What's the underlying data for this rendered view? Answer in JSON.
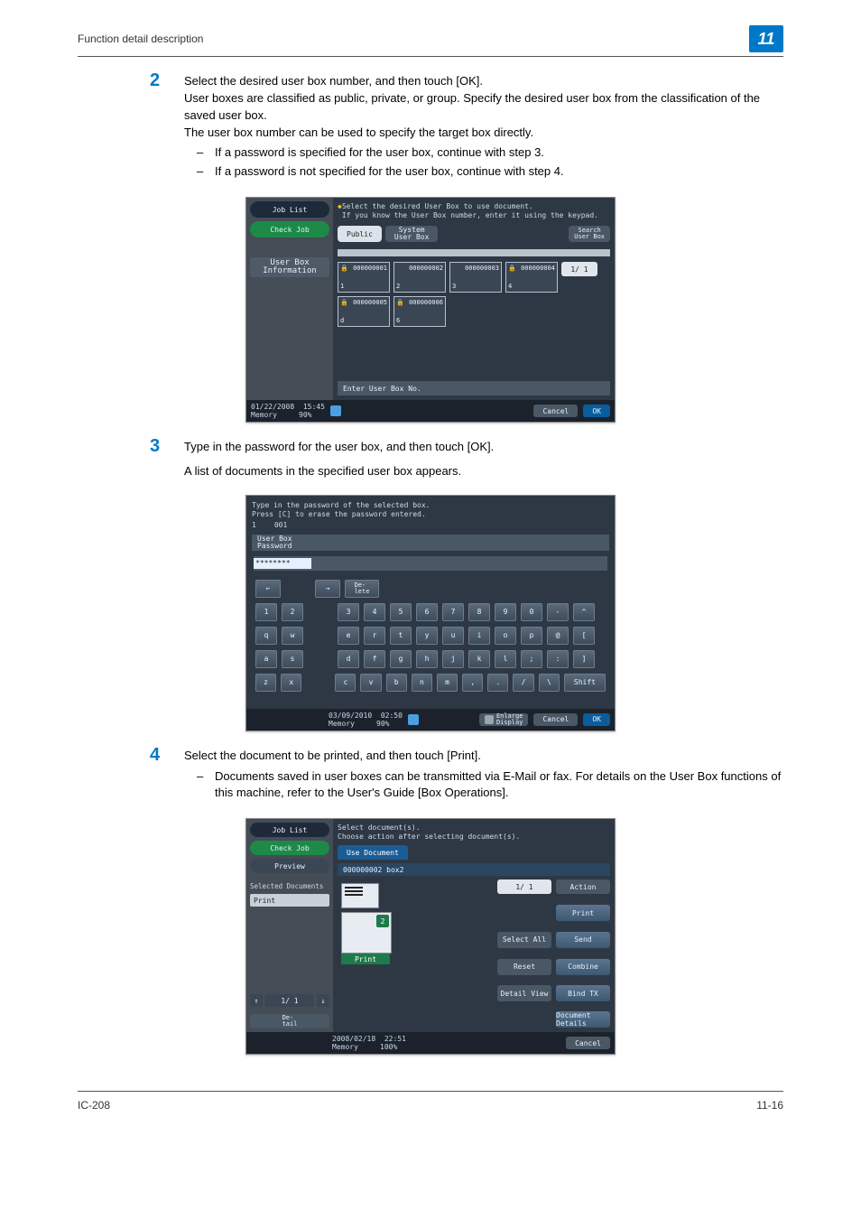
{
  "header": {
    "title": "Function detail description",
    "chapter_number": "11"
  },
  "steps": {
    "s2": {
      "num": "2",
      "p1": "Select the desired user box number, and then touch [OK].",
      "p2": "User boxes are classified as public, private, or group. Specify the desired user box from the classification of the saved user box.",
      "p3": "The user box number can be used to specify the target box directly.",
      "b1": "If a password is specified for the user box, continue with step 3.",
      "b2": "If a password is not specified for the user box, continue with step 4."
    },
    "s3": {
      "num": "3",
      "p1": "Type in the password for the user box, and then touch [OK].",
      "p2": "A list of documents in the specified user box appears."
    },
    "s4": {
      "num": "4",
      "p1": "Select the document to be printed, and then touch [Print].",
      "b1": "Documents saved in user boxes can be transmitted via E-Mail or fax. For details on the User Box functions of this machine, refer to the User's Guide [Box Operations]."
    }
  },
  "shot1": {
    "left": {
      "job_list": "Job List",
      "check_job": "Check Job",
      "user_box_info": "User Box\nInformation"
    },
    "hint_line1": "Select the desired User Box to use document.",
    "hint_line2": "If you know the User Box number, enter it using the keypad.",
    "tab_public": "Public",
    "tab_system": "System\nUser Box",
    "search": "Search\nUser Box",
    "boxes": [
      {
        "num": "000000001",
        "label": "1",
        "lock": true
      },
      {
        "num": "000000002",
        "label": "2",
        "lock": false
      },
      {
        "num": "000000003",
        "label": "3",
        "lock": false
      },
      {
        "num": "000000004",
        "label": "4",
        "lock": true
      },
      {
        "num": "000000005",
        "label": "d",
        "lock": true
      },
      {
        "num": "000000006",
        "label": "6",
        "lock": true
      }
    ],
    "page_count": "1/ 1",
    "enter_label": "Enter User Box No.",
    "footer": {
      "date": "01/22/2008",
      "time": "15:45",
      "memory": "Memory",
      "memory_pct": "90%",
      "cancel": "Cancel",
      "ok": "OK"
    }
  },
  "shot2": {
    "hint_line1": "Type in the password of the selected box.",
    "hint_line2": "Press [C] to erase the password entered.",
    "hint_num": "1",
    "hint_id": "001",
    "tab": "User Box\nPassword",
    "input_value": "********",
    "keys": {
      "left_arrow": "←",
      "right_arrow": "→",
      "delete": "De-\nlete",
      "row1": [
        "1",
        "2",
        "3",
        "4",
        "5",
        "6",
        "7",
        "8",
        "9",
        "0",
        "-",
        "^"
      ],
      "row2": [
        "q",
        "w",
        "e",
        "r",
        "t",
        "y",
        "u",
        "i",
        "o",
        "p",
        "@",
        "["
      ],
      "row3": [
        "a",
        "s",
        "d",
        "f",
        "g",
        "h",
        "j",
        "k",
        "l",
        ";",
        ":",
        "]"
      ],
      "row4": [
        "z",
        "x",
        "c",
        "v",
        "b",
        "n",
        "m",
        ",",
        ".",
        "/",
        "\\"
      ],
      "shift": "Shift"
    },
    "footer": {
      "date": "03/09/2010",
      "time": "02:50",
      "memory": "Memory",
      "memory_pct": "90%",
      "lang": "Enlarge\nDisplay",
      "cancel": "Cancel",
      "ok": "OK"
    }
  },
  "shot3": {
    "left": {
      "job_list": "Job List",
      "check_job": "Check Job",
      "preview": "Preview",
      "selected_docs": "Selected Documents",
      "print": "Print",
      "page_nav": "1/ 1",
      "up": "↑",
      "down": "↓",
      "detail_btn": "De-\ntail"
    },
    "hint_line1": "Select document(s).",
    "hint_line2": "Choose action after selecting document(s).",
    "tab": "Use Document",
    "subbar": "000000002  box2",
    "thumb_badge": "2",
    "thumb_caption": "Print",
    "right_col": {
      "page_count": "1/ 1",
      "select_all": "Select\nAll",
      "reset": "Reset",
      "detail_view": "Detail\nView",
      "action": "Action",
      "print": "Print",
      "send": "Send",
      "combine": "Combine",
      "bind_tx": "Bind TX",
      "doc_details": "Document\nDetails"
    },
    "footer": {
      "date": "2008/02/18",
      "time": "22:51",
      "memory": "Memory",
      "memory_pct": "100%",
      "cancel": "Cancel"
    }
  },
  "footer": {
    "left": "IC-208",
    "right": "11-16"
  }
}
